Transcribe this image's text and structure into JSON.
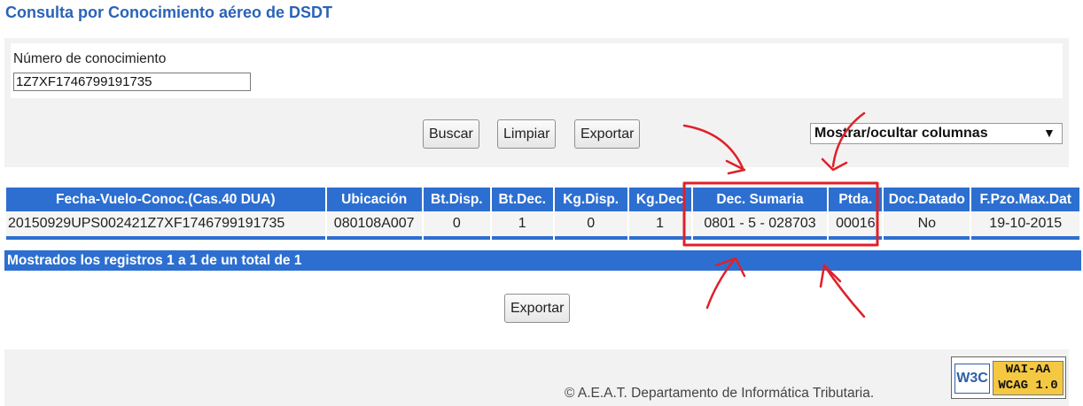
{
  "page": {
    "title": "Consulta por Conocimiento aéreo de DSDT"
  },
  "search": {
    "label": "Número de conocimiento",
    "value": "1Z7XF1746799191735"
  },
  "actions": {
    "buscar": "Buscar",
    "limpiar": "Limpiar",
    "exportar": "Exportar",
    "columns_select": "Mostrar/ocultar columnas",
    "columns_caret": "▼"
  },
  "table": {
    "headers": [
      "Fecha-Vuelo-Conoc.(Cas.40 DUA)",
      "Ubicación",
      "Bt.Disp.",
      "Bt.Dec.",
      "Kg.Disp.",
      "Kg.Dec",
      "Dec. Sumaria",
      "Ptda.",
      "Doc.Datado",
      "F.Pzo.Max.Dat"
    ],
    "rows": [
      [
        "20150929UPS002421Z7XF1746799191735",
        "080108A007",
        "0",
        "1",
        "0",
        "1",
        "0801 - 5 - 028703",
        "00016",
        "No",
        "19-10-2015"
      ]
    ],
    "footer": "Mostrados los registros 1 a 1 de un total de 1"
  },
  "bottom": {
    "export": "Exportar"
  },
  "footer": {
    "copyright": "© A.E.A.T. Departamento de Informática Tributaria.",
    "badge": {
      "w3c": "W3C",
      "line1": "WAI-AA",
      "line2": "WCAG 1.0"
    }
  },
  "colors": {
    "accent": "#2d6fd0",
    "title": "#2a63b9",
    "annotation": "#e0202a",
    "panel": "#f2f2f2"
  }
}
